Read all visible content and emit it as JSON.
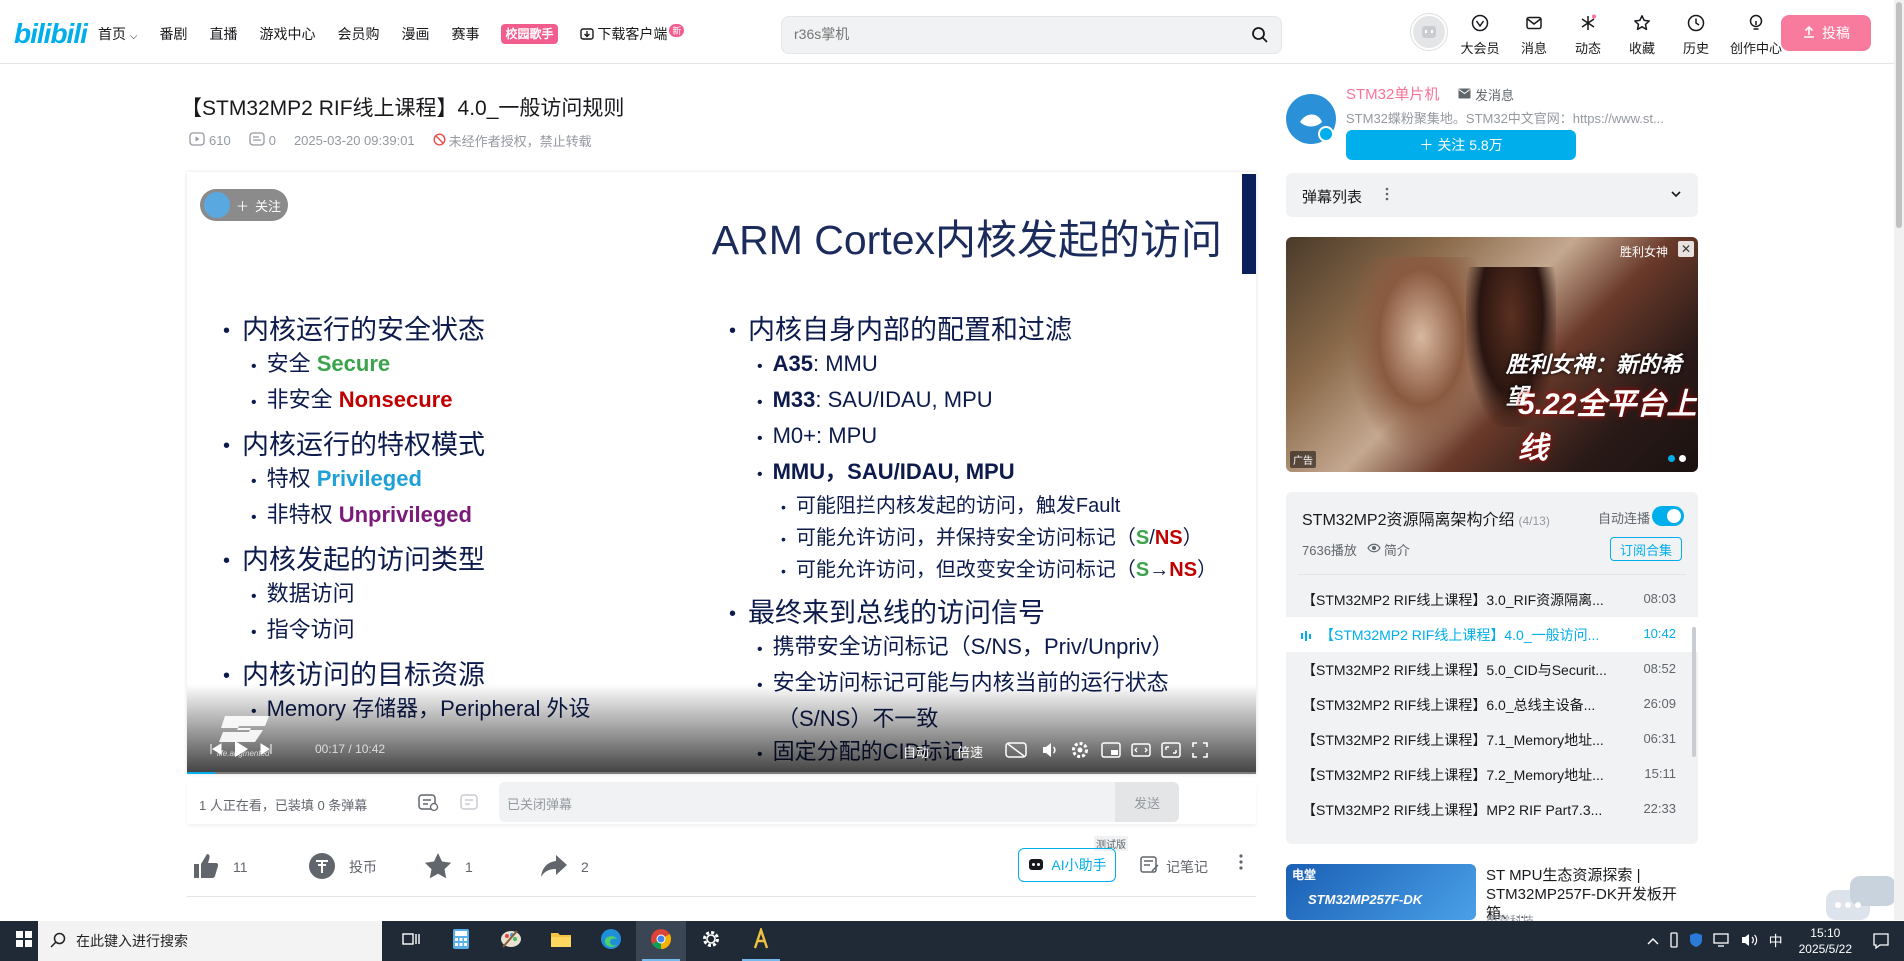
{
  "header": {
    "logo": "bilibili",
    "nav": [
      "首页",
      "番剧",
      "直播",
      "游戏中心",
      "会员购",
      "漫画",
      "赛事",
      "校园歌手",
      "下载客户端"
    ],
    "new_badge": "新",
    "search_placeholder": "r36s掌机",
    "icons": [
      {
        "label": "大会员",
        "icon": "vip-icon"
      },
      {
        "label": "消息",
        "icon": "message-icon"
      },
      {
        "label": "动态",
        "icon": "dynamic-icon"
      },
      {
        "label": "收藏",
        "icon": "favorite-icon"
      },
      {
        "label": "历史",
        "icon": "history-icon"
      },
      {
        "label": "创作中心",
        "icon": "creator-icon"
      }
    ],
    "upload_label": "投稿"
  },
  "video": {
    "title": "【STM32MP2 RIF线上课程】4.0_一般访问规则",
    "views": "610",
    "danmaku_count": "0",
    "date": "2025-03-20 09:39:01",
    "notice": "未经作者授权，禁止转载"
  },
  "player": {
    "follow_label": "关注",
    "slide_title": "ARM Cortex内核发起的访问",
    "left_col": [
      {
        "lvl": 1,
        "parts": [
          {
            "t": "内核运行的安全状态"
          }
        ]
      },
      {
        "lvl": 2,
        "parts": [
          {
            "t": "安全 "
          },
          {
            "t": "Secure",
            "c": "green"
          }
        ]
      },
      {
        "lvl": 2,
        "parts": [
          {
            "t": "非安全 "
          },
          {
            "t": "Nonsecure",
            "c": "red"
          }
        ]
      },
      {
        "lvl": 1,
        "parts": [
          {
            "t": "内核运行的特权模式"
          }
        ]
      },
      {
        "lvl": 2,
        "parts": [
          {
            "t": "特权 "
          },
          {
            "t": "Privileged",
            "c": "blue"
          }
        ]
      },
      {
        "lvl": 2,
        "parts": [
          {
            "t": "非特权 "
          },
          {
            "t": "Unprivileged",
            "c": "purple"
          }
        ]
      },
      {
        "lvl": 1,
        "parts": [
          {
            "t": "内核发起的访问类型"
          }
        ]
      },
      {
        "lvl": 2,
        "parts": [
          {
            "t": "数据访问"
          }
        ]
      },
      {
        "lvl": 2,
        "parts": [
          {
            "t": "指令访问"
          }
        ]
      },
      {
        "lvl": 1,
        "parts": [
          {
            "t": "内核访问的目标资源"
          }
        ]
      },
      {
        "lvl": 2,
        "parts": [
          {
            "t": "Memory 存储器，Peripheral 外设"
          }
        ]
      }
    ],
    "right_col": [
      {
        "lvl": 1,
        "parts": [
          {
            "t": "内核自身内部的配置和过滤"
          }
        ]
      },
      {
        "lvl": 2,
        "parts": [
          {
            "t": "A35",
            "c": "bold"
          },
          {
            "t": ": MMU"
          }
        ]
      },
      {
        "lvl": 2,
        "parts": [
          {
            "t": "M33",
            "c": "bold"
          },
          {
            "t": ": SAU/IDAU, MPU"
          }
        ]
      },
      {
        "lvl": 2,
        "parts": [
          {
            "t": "M0+: MPU"
          }
        ]
      },
      {
        "lvl": 2,
        "parts": [
          {
            "t": "MMU，SAU/IDAU, MPU",
            "c": "bold"
          }
        ]
      },
      {
        "lvl": 3,
        "parts": [
          {
            "t": "可能阻拦内核发起的访问，触发Fault"
          }
        ]
      },
      {
        "lvl": 3,
        "parts": [
          {
            "t": "可能允许访问，并保持安全访问标记（"
          },
          {
            "t": "S",
            "c": "green"
          },
          {
            "t": "/"
          },
          {
            "t": "NS",
            "c": "red"
          },
          {
            "t": "）"
          }
        ]
      },
      {
        "lvl": 3,
        "parts": [
          {
            "t": "可能允许访问，但改变安全访问标记（"
          },
          {
            "t": "S",
            "c": "green"
          },
          {
            "t": "→",
            "c": "bold"
          },
          {
            "t": "NS",
            "c": "red"
          },
          {
            "t": "）"
          }
        ]
      },
      {
        "lvl": 1,
        "parts": [
          {
            "t": "最终来到总线的访问信号"
          }
        ]
      },
      {
        "lvl": 2,
        "parts": [
          {
            "t": "携带安全访问标记（S/NS，Priv/Unpriv）"
          }
        ]
      },
      {
        "lvl": 2,
        "parts": [
          {
            "t": "安全访问标记可能与内核当前的运行状态（S/NS）不一致"
          }
        ]
      },
      {
        "lvl": 2,
        "parts": [
          {
            "t": "固定分配的CID标记"
          }
        ]
      }
    ],
    "st_tagline": "life.augmented",
    "time_current": "00:17",
    "time_sep": "/",
    "time_total": "10:42",
    "quality_label": "自动",
    "speed_label": "倍速",
    "progress": 0.026
  },
  "danmaku_bar": {
    "watching": "1 人正在看，已装填 0 条弹幕",
    "placeholder": "已关闭弹幕",
    "send_label": "发送"
  },
  "actions": {
    "like": "11",
    "coin": "投币",
    "favorite": "1",
    "share": "2",
    "ai_label": "AI小助手",
    "ai_tag": "测试版",
    "notes_label": "记笔记"
  },
  "uploader": {
    "name": "STM32单片机",
    "message_label": "发消息",
    "description": "STM32蝶粉聚集地。STM32中文官网：https://www.st...",
    "follow_label": "关注 5.8万"
  },
  "danmaku_list": {
    "label": "弹幕列表"
  },
  "ad": {
    "badge": "广告",
    "brand": "胜利女神",
    "line1": "胜利女神：新的希望",
    "line2": "5.22全平台上线"
  },
  "playlist": {
    "title": "STM32MP2资源隔离架构介绍",
    "count": "(4/13)",
    "autoplay_label": "自动连播",
    "plays": "7636播放",
    "intro_label": "简介",
    "subscribe_label": "订阅合集",
    "items": [
      {
        "title": "【STM32MP2 RIF线上课程】3.0_RIF资源隔离...",
        "dur": "08:03"
      },
      {
        "title": "【STM32MP2 RIF线上课程】4.0_一般访问...",
        "dur": "10:42",
        "active": true
      },
      {
        "title": "【STM32MP2 RIF线上课程】5.0_CID与Securit...",
        "dur": "08:52"
      },
      {
        "title": "【STM32MP2 RIF线上课程】6.0_总线主设备...",
        "dur": "26:09"
      },
      {
        "title": "【STM32MP2 RIF线上课程】7.1_Memory地址...",
        "dur": "06:31"
      },
      {
        "title": "【STM32MP2 RIF线上课程】7.2_Memory地址...",
        "dur": "15:11"
      },
      {
        "title": "【STM32MP2 RIF线上课程】MP2 RIF Part7.3...",
        "dur": "22:33"
      }
    ]
  },
  "recommend": {
    "title": "ST MPU生态资源探索 | STM32MP257F-DK开发板开箱、...",
    "author": "电堂科技",
    "thumb_tag": "电堂",
    "thumb_text": "STM32MP257F-DK"
  },
  "taskbar": {
    "search_placeholder": "在此键入进行搜索",
    "ime": "中",
    "time": "15:10",
    "date": "2025/5/22"
  },
  "colors": {
    "accent": "#00aeec",
    "pink": "#fb7299"
  }
}
